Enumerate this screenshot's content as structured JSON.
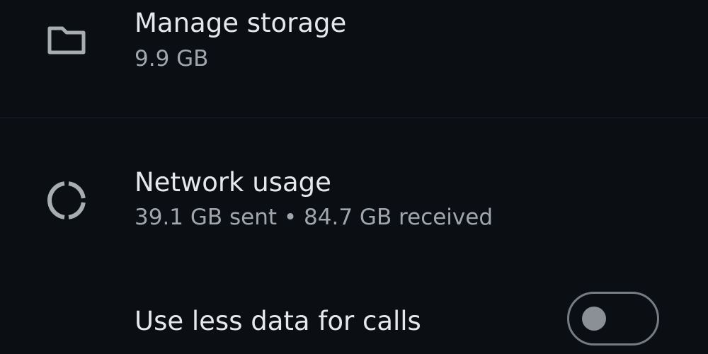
{
  "storage": {
    "icon": "folder-icon",
    "title": "Manage storage",
    "subtitle": "9.9 GB"
  },
  "network": {
    "icon": "data-usage-icon",
    "title": "Network usage",
    "subtitle": "39.1 GB sent • 84.7 GB received"
  },
  "calls": {
    "title": "Use less data for calls",
    "toggle_on": false
  },
  "colors": {
    "background": "#0b0f13",
    "title_text": "#e6e9ec",
    "subtitle_text": "#a0a6ac",
    "icon": "#a8adb2",
    "toggle_border": "#767c82",
    "toggle_knob": "#8a9096"
  }
}
